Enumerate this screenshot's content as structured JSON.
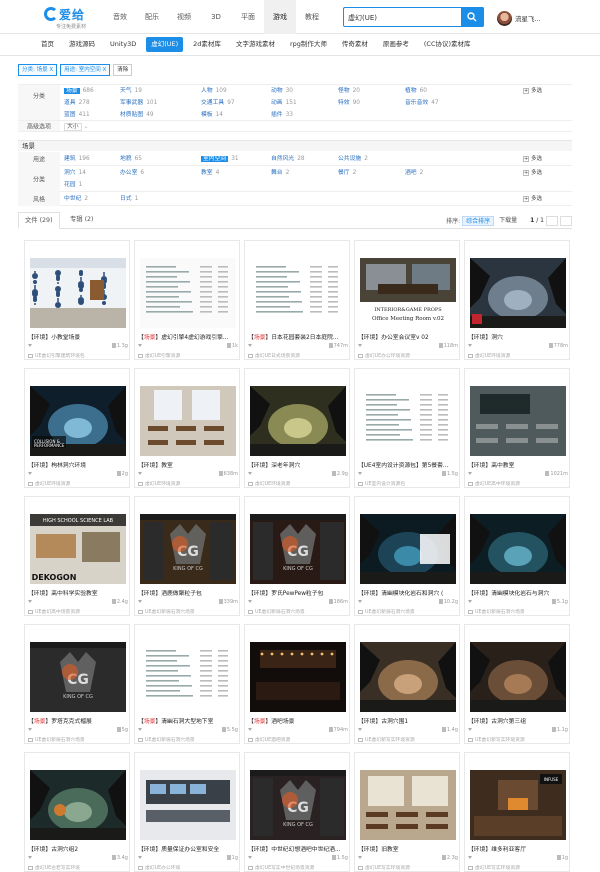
{
  "logo": {
    "text": "爱给",
    "slogan": "专注免费素材"
  },
  "nav": [
    {
      "label": "音效"
    },
    {
      "label": "配乐"
    },
    {
      "label": "视频"
    },
    {
      "label": "3D"
    },
    {
      "label": "平面"
    },
    {
      "label": "游戏",
      "active": true
    },
    {
      "label": "教程"
    }
  ],
  "search": {
    "value": "虚幻(UE)"
  },
  "user": {
    "name": "流星飞..."
  },
  "subnav": [
    "首页",
    "游戏源码",
    "Unity3D",
    "虚幻(UE)",
    "2d素材库",
    "文字游戏素材",
    "rpg制作大师",
    "传奇素材",
    "原画参考",
    "(CC协议)素材库"
  ],
  "subnav_active": 3,
  "crumbs": [
    "分类: 场景 X",
    "用途: 室内空间 X",
    "清除"
  ],
  "filter1": {
    "label": "分类",
    "rows": [
      [
        {
          "k": "场景",
          "n": "686",
          "sel": true
        },
        {
          "k": "天气",
          "n": "19"
        },
        {
          "k": "人物",
          "n": "109"
        },
        {
          "k": "动物",
          "n": "30"
        },
        {
          "k": "怪物",
          "n": "20"
        },
        {
          "k": "植物",
          "n": "60"
        }
      ],
      [
        {
          "k": "道具",
          "n": "278"
        },
        {
          "k": "军事武器",
          "n": "101"
        },
        {
          "k": "交通工具",
          "n": "97"
        },
        {
          "k": "动画",
          "n": "151"
        },
        {
          "k": "特效",
          "n": "90"
        },
        {
          "k": "音乐音效",
          "n": "47"
        }
      ],
      [
        {
          "k": "蓝图",
          "n": "411"
        },
        {
          "k": "材质贴图",
          "n": "49"
        },
        {
          "k": "模板",
          "n": "14"
        },
        {
          "k": "插件",
          "n": "33"
        }
      ]
    ],
    "more": "多选"
  },
  "advanced": {
    "label": "高级选项",
    "size": "大小"
  },
  "scene_head": "场景",
  "filter2": [
    {
      "label": "用途",
      "items": [
        {
          "k": "建筑",
          "n": "196"
        },
        {
          "k": "地貌",
          "n": "65"
        },
        {
          "k": "室内空间",
          "n": "31",
          "sel": true
        },
        {
          "k": "自然风光",
          "n": "28"
        },
        {
          "k": "公共设施",
          "n": "2"
        }
      ],
      "more": "多选"
    },
    {
      "label": "分类",
      "items": [
        {
          "k": "洞穴",
          "n": "14"
        },
        {
          "k": "办公室",
          "n": "6"
        },
        {
          "k": "教室",
          "n": "4"
        },
        {
          "k": "舞台",
          "n": "2"
        },
        {
          "k": "餐厅",
          "n": "2"
        },
        {
          "k": "酒吧",
          "n": "2"
        }
      ],
      "items2": [
        {
          "k": "花园",
          "n": "1"
        }
      ],
      "more": "多选"
    },
    {
      "label": "风格",
      "items": [
        {
          "k": "中世纪",
          "n": "2"
        },
        {
          "k": "日式",
          "n": "1"
        }
      ],
      "more": "多选"
    }
  ],
  "tabs": [
    {
      "label": "文件 (29)",
      "active": true
    },
    {
      "label": "专辑 (2)"
    }
  ],
  "sort": {
    "label": "排序:",
    "options": [
      "综合排序",
      "下载量"
    ],
    "active": 0,
    "page": "1",
    "total": "/ 1"
  },
  "cards": [
    {
      "pre": "【环境】",
      "hl": "",
      "title": "小教堂场景",
      "hl2": "场景",
      "post": "",
      "size": "1.3g",
      "cat": "UE虚幻引擎建筑环境包",
      "t": "chapel"
    },
    {
      "pre": "【",
      "hl": "场景",
      "title": "】虚幻引擎4虚幻游戏引擎...",
      "size": "1k",
      "cat": "虚幻UE引擎资源",
      "t": "list"
    },
    {
      "pre": "【",
      "hl": "场景",
      "title": "】日本花园套装2日本庭院...",
      "size": "747m",
      "cat": "虚幻UE日式场景资源",
      "t": "list2"
    },
    {
      "pre": "【环境】",
      "hl": "",
      "title": "办公室会议室v 02",
      "size": "118m",
      "cat": "虚幻UE办公环境资源",
      "t": "office"
    },
    {
      "pre": "【环境】",
      "hl": "",
      "title": "洞穴",
      "size": "778m",
      "cat": "虚幻UE环境资源",
      "t": "cave"
    },
    {
      "pre": "【环境】",
      "hl": "",
      "title": "枸林洞穴环境",
      "size": "2g",
      "cat": "虚幻UE环境资源",
      "t": "cave2"
    },
    {
      "pre": "【环境】",
      "hl": "",
      "title": "教室",
      "size": "638m",
      "cat": "虚幻UE环境资源",
      "t": "classroom"
    },
    {
      "pre": "【环境】",
      "hl": "",
      "title": "深老年洞穴",
      "size": "2.9g",
      "cat": "虚幻UE环境资源",
      "t": "cave3"
    },
    {
      "pre": "【UE4室内设计资源包】",
      "hl": "",
      "title": "第5餐套...",
      "size": "1.5g",
      "cat": "UE室内设计资源包",
      "t": "list3"
    },
    {
      "pre": "【环境】",
      "hl": "",
      "title": "高中教室",
      "size": "1021m",
      "cat": "虚幻UE高中环境资源",
      "t": "hsroom"
    },
    {
      "pre": "【环境】",
      "hl": "",
      "title": "高中科学实验教室",
      "size": "2.4g",
      "cat": "UE虚幻高中场景资源",
      "t": "lab"
    },
    {
      "pre": "【环境】",
      "hl": "",
      "title": "酒鹿做聚粒子包",
      "size": "339m",
      "cat": "UE虚幻新骑石洞穴场景",
      "t": "cg1"
    },
    {
      "pre": "【环境】",
      "hl": "",
      "title": "罗氏PewPew粒子包",
      "size": "186m",
      "cat": "UE虚幻新骑石洞穴场景",
      "t": "cg2"
    },
    {
      "pre": "【环境】",
      "hl": "",
      "title": "清幽模块化岩石和洞穴 (",
      "size": "10.2g",
      "cat": "UE虚幻新骑石洞穴场景",
      "t": "cave4"
    },
    {
      "pre": "【环境】",
      "hl": "",
      "title": "清幽模块化岩石与洞穴",
      "size": "5.1g",
      "cat": "UE虚幻新骑石洞穴场景",
      "t": "cave5"
    },
    {
      "pre": "【",
      "hl": "场景",
      "title": "】罗塔克克式榴展",
      "size": "5g",
      "cat": "UE虚幻新骑石洞穴场景",
      "t": "cg3"
    },
    {
      "pre": "【",
      "hl": "场景",
      "title": "】清幽石洞大型地下室",
      "size": "5.5g",
      "cat": "UE虚幻新骑石洞穴场景",
      "t": "list4"
    },
    {
      "pre": "【",
      "hl": "场景",
      "title": "】酒吧场景",
      "size": "794m",
      "cat": "虚幻UE酒吧资源",
      "t": "bar"
    },
    {
      "pre": "【环境】",
      "hl": "",
      "title": "古洞穴围1",
      "size": "1.4g",
      "cat": "UE虚幻新写实环境资源",
      "t": "cave6"
    },
    {
      "pre": "【环境】",
      "hl": "",
      "title": "古洞穴第三组",
      "size": "1.1g",
      "cat": "UE虚幻新写实环境资源",
      "t": "cave7"
    },
    {
      "pre": "【环境】",
      "hl": "",
      "title": "古洞穴组2",
      "size": "3.4g",
      "cat": "虚幻UE古老写实环境",
      "t": "cave8"
    },
    {
      "pre": "【环境】",
      "hl": "",
      "title": "质量保证办公室和安全",
      "size": "1g",
      "cat": "虚幻UE办公环境",
      "t": "officeq"
    },
    {
      "pre": "【环境】",
      "hl": "",
      "title": "中世纪幻想酒吧中世纪酒...",
      "size": "1.5g",
      "cat": "虚幻UE写实中世纪场景资源",
      "t": "cg4"
    },
    {
      "pre": "【环境】",
      "hl": "",
      "title": "旧教室",
      "size": "2.3g",
      "cat": "虚幻UE写实环境资源",
      "t": "oldroom"
    },
    {
      "pre": "【环境】",
      "hl": "",
      "title": "维多利亚客厅",
      "size": "1g",
      "cat": "虚幻UE写实环境资源",
      "t": "victorian"
    }
  ]
}
